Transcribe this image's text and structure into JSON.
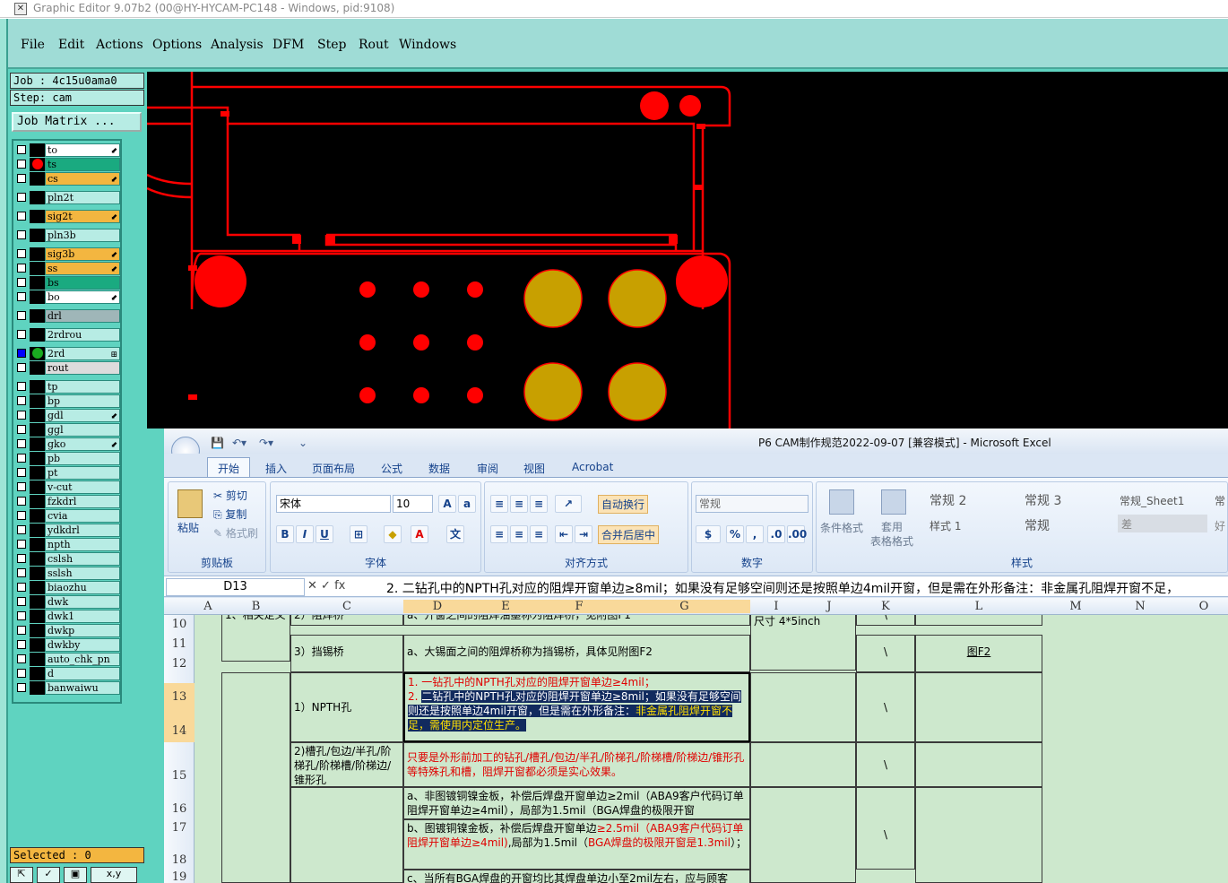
{
  "window": {
    "title": "Graphic Editor 9.07b2 (00@HY-HYCAM-PC148 - Windows, pid:9108)"
  },
  "menu": [
    "File",
    "Edit",
    "Actions",
    "Options",
    "Analysis",
    "DFM",
    "Step",
    "Rout",
    "Windows"
  ],
  "job": {
    "job_label": "Job : 4c15u0ama0",
    "step_label": "Step: cam",
    "matrix_button": "Job Matrix ...",
    "selected": "Selected : 0"
  },
  "layers": [
    {
      "name": "to",
      "color": "#ffffff",
      "dot": "",
      "mark": "⬋"
    },
    {
      "name": "ts",
      "color": "#1aaa80",
      "dot": "#ff0000",
      "mark": ""
    },
    {
      "name": "cs",
      "color": "#f3b640",
      "dot": "",
      "mark": "⬋"
    },
    {
      "name": "pln2t",
      "color": "#b7ece4",
      "dot": "",
      "mark": ""
    },
    {
      "name": "sig2t",
      "color": "#f3b640",
      "dot": "",
      "mark": "⬋"
    },
    {
      "name": "pln3b",
      "color": "#b7ece4",
      "dot": "",
      "mark": ""
    },
    {
      "name": "sig3b",
      "color": "#f3b640",
      "dot": "",
      "mark": "⬋"
    },
    {
      "name": "ss",
      "color": "#f3b640",
      "dot": "",
      "mark": "⬋"
    },
    {
      "name": "bs",
      "color": "#1aaa80",
      "dot": "",
      "mark": ""
    },
    {
      "name": "bo",
      "color": "#ffffff",
      "dot": "",
      "mark": "⬋"
    },
    {
      "name": "drl",
      "color": "#9fb6b8",
      "dot": "",
      "mark": ""
    },
    {
      "name": "2rdrou",
      "color": "#b7ece4",
      "dot": "",
      "mark": ""
    },
    {
      "name": "2rd",
      "color": "#b7ece4",
      "dot": "#1aaa20",
      "mark": "⊞"
    },
    {
      "name": "rout",
      "color": "#dcdcdc",
      "dot": "",
      "mark": ""
    },
    {
      "name": "tp",
      "color": "#b7ece4",
      "dot": "",
      "mark": ""
    },
    {
      "name": "bp",
      "color": "#b7ece4",
      "dot": "",
      "mark": ""
    },
    {
      "name": "gdl",
      "color": "#b7ece4",
      "dot": "",
      "mark": "⬋"
    },
    {
      "name": "ggl",
      "color": "#b7ece4",
      "dot": "",
      "mark": ""
    },
    {
      "name": "gko",
      "color": "#b7ece4",
      "dot": "",
      "mark": "⬋"
    },
    {
      "name": "pb",
      "color": "#b7ece4",
      "dot": "",
      "mark": ""
    },
    {
      "name": "pt",
      "color": "#b7ece4",
      "dot": "",
      "mark": ""
    },
    {
      "name": "v-cut",
      "color": "#b7ece4",
      "dot": "",
      "mark": ""
    },
    {
      "name": "fzkdrl",
      "color": "#b7ece4",
      "dot": "",
      "mark": ""
    },
    {
      "name": "cvia",
      "color": "#b7ece4",
      "dot": "",
      "mark": ""
    },
    {
      "name": "ydkdrl",
      "color": "#b7ece4",
      "dot": "",
      "mark": ""
    },
    {
      "name": "npth",
      "color": "#b7ece4",
      "dot": "",
      "mark": ""
    },
    {
      "name": "cslsh",
      "color": "#b7ece4",
      "dot": "",
      "mark": ""
    },
    {
      "name": "sslsh",
      "color": "#b7ece4",
      "dot": "",
      "mark": ""
    },
    {
      "name": "biaozhu",
      "color": "#b7ece4",
      "dot": "",
      "mark": ""
    },
    {
      "name": "dwk",
      "color": "#b7ece4",
      "dot": "",
      "mark": ""
    },
    {
      "name": "dwk1",
      "color": "#b7ece4",
      "dot": "",
      "mark": ""
    },
    {
      "name": "dwkp",
      "color": "#b7ece4",
      "dot": "",
      "mark": ""
    },
    {
      "name": "dwkby",
      "color": "#b7ece4",
      "dot": "",
      "mark": ""
    },
    {
      "name": "auto_chk_pn",
      "color": "#b7ece4",
      "dot": "",
      "mark": ""
    },
    {
      "name": "d",
      "color": "#b7ece4",
      "dot": "",
      "mark": ""
    },
    {
      "name": "banwaiwu",
      "color": "#b7ece4",
      "dot": "",
      "mark": ""
    }
  ],
  "excel": {
    "title": "P6 CAM制作规范2022-09-07  [兼容模式] - Microsoft Excel",
    "tabs": [
      "开始",
      "插入",
      "页面布局",
      "公式",
      "数据",
      "审阅",
      "视图",
      "Acrobat"
    ],
    "clipboard": {
      "paste": "粘贴",
      "cut": "剪切",
      "copy": "复制",
      "format_painter": "格式刷",
      "group": "剪贴板"
    },
    "font": {
      "name": "宋体",
      "size": "10",
      "group": "字体"
    },
    "align": {
      "wrap": "自动换行",
      "merge": "合并后居中",
      "group": "对齐方式"
    },
    "number": {
      "format": "常规",
      "group": "数字"
    },
    "styles": {
      "cond": "条件格式",
      "table": "套用\n表格格式",
      "s1": "常规 2",
      "s2": "常规 3",
      "s3": "常规_Sheet1",
      "s4": "常",
      "s5": "样式 1",
      "s6": "常规",
      "s7": "差",
      "s8": "好",
      "group": "样式"
    },
    "name_box": "D13",
    "formula": "2.  二钻孔中的NPTH孔对应的阻焊开窗单边≥8mil；如果没有足够空间则还是按照单边4mil开窗，但是需在外形备注：非金属孔阻焊开窗不足，",
    "columns": [
      "A",
      "B",
      "C",
      "D",
      "E",
      "F",
      "G",
      "I",
      "J",
      "K",
      "L",
      "M",
      "N",
      "O"
    ],
    "rows": [
      "10",
      "11",
      "12",
      "13",
      "14",
      "15",
      "16",
      "17",
      "18",
      "19"
    ],
    "cells": {
      "b10": "1、相关定义",
      "c10": "2）阻焊桥",
      "d10": "a、开窗之间的阻焊油墨称为阻焊桥，见附图F1",
      "i10": "尺寸 4*5inch",
      "k10": "\\",
      "c11": "3）挡锡桥",
      "d11": "a、大锡面之间的阻焊桥称为挡锡桥，具体见附图F2",
      "k11": "\\",
      "l11": "图F2",
      "c13": "1）NPTH孔",
      "d13a": "1. 一钻孔中的NPTH孔对应的阻焊开窗单边≥4mil；",
      "d13b_num": "2. ",
      "d13b": "二钻孔中的NPTH孔对应的阻焊开窗单边≥8mil；如果没有足够空间则还是按照单边4mil开窗，但是需在外形备注：",
      "d13c": "非金属孔阻焊开窗不足，需使用内定位生产。",
      "k13": "\\",
      "c15": "2)槽孔/包边/半孔/阶梯孔/阶梯槽/阶梯边/锥形孔",
      "d15": "只要是外形前加工的钻孔/槽孔/包边/半孔/阶梯孔/阶梯槽/阶梯边/锥形孔等特殊孔和槽，阻焊开窗都必须是实心效果。",
      "k15": "\\",
      "d16": "a、非图镀铜镍金板，补偿后焊盘开窗单边≥2mil（ABA9客户代码订单阻焊开窗单边≥4mil），局部为1.5mil（BGA焊盘的极限开窗",
      "d17a": "b、图镀铜镍金板，补偿后焊盘开窗单边",
      "d17b": "≥2.5mil（ABA9客户代码订单阻焊开窗单边≥4mil)",
      "d17c": ",局部为1.5mil（",
      "d17d": "BGA焊盘的极限开窗是1.3mil",
      "d17e": "）；",
      "k17": "\\",
      "d19": "c、当所有BGA焊盘的开窗均比其焊盘单边小至2mil左右，应与顾客"
    }
  },
  "colors": {
    "accent": "#5fd3c0",
    "copper": "#ff0000",
    "pad": "#c8a000"
  }
}
